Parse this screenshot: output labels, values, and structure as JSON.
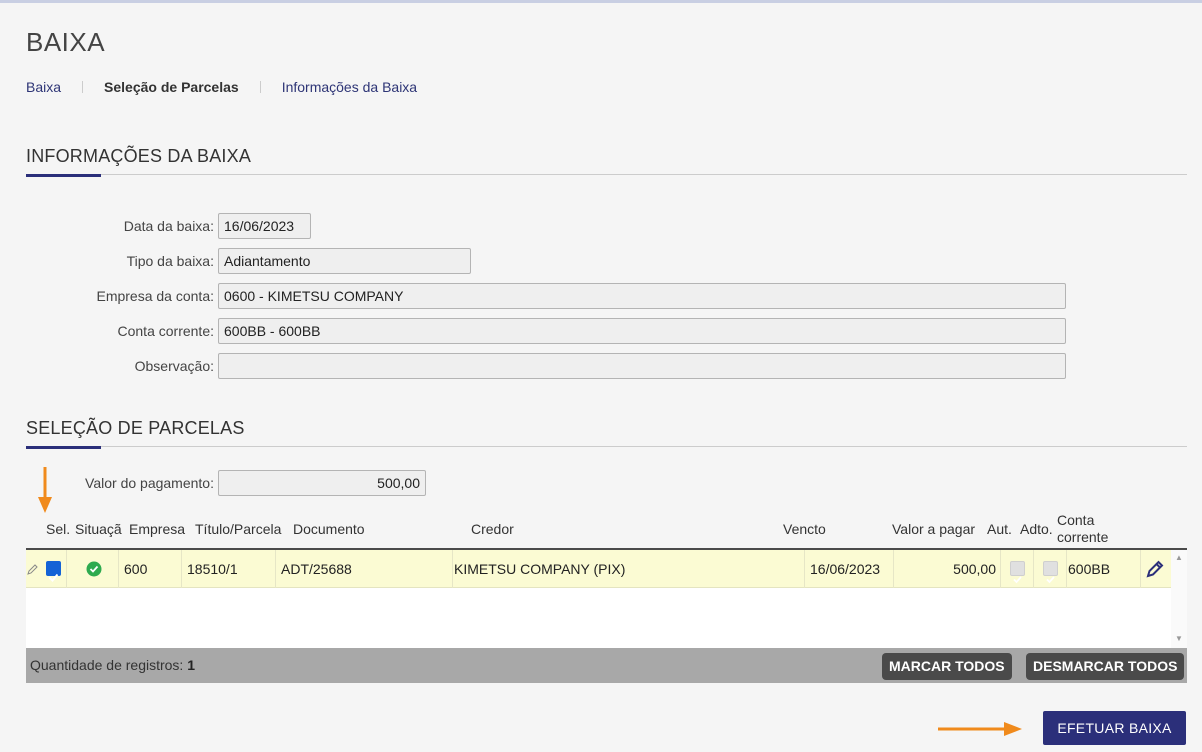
{
  "page": {
    "title": "BAIXA"
  },
  "breadcrumb": [
    {
      "label": "Baixa"
    },
    {
      "label": "Seleção de Parcelas"
    },
    {
      "label": "Informações da Baixa"
    }
  ],
  "info_section": {
    "title": "INFORMAÇÕES DA BAIXA",
    "fields": {
      "data": {
        "label": "Data da baixa:",
        "value": "16/06/2023"
      },
      "tipo": {
        "label": "Tipo da baixa:",
        "value": "Adiantamento"
      },
      "empresa": {
        "label": "Empresa da conta:",
        "value": "0600 - KIMETSU COMPANY"
      },
      "conta": {
        "label": "Conta corrente:",
        "value": "600BB - 600BB"
      },
      "obs": {
        "label": "Observação:",
        "value": ""
      }
    }
  },
  "parcelas_section": {
    "title": "SELEÇÃO DE PARCELAS",
    "valor_label": "Valor do pagamento:",
    "valor_value": "500,00",
    "columns": {
      "sel": "Sel.",
      "situacao": "Situaçã",
      "empresa": "Empresa",
      "titulo": "Título/Parcela",
      "documento": "Documento",
      "credor": "Credor",
      "vencto": "Vencto",
      "valor": "Valor a pagar",
      "aut": "Aut.",
      "adto": "Adto.",
      "conta_l1": "Conta",
      "conta_l2": "corrente"
    },
    "rows": [
      {
        "selected": true,
        "status": "ok",
        "empresa": "600",
        "titulo": "18510/1",
        "documento": "ADT/25688",
        "credor": "KIMETSU COMPANY (PIX)",
        "vencto": "16/06/2023",
        "valor": "500,00",
        "aut": true,
        "adto": true,
        "conta": "600BB"
      }
    ],
    "footer": {
      "records_label": "Quantidade de registros:",
      "records_count": "1",
      "mark_all": "MARCAR TODOS",
      "unmark_all": "DESMARCAR TODOS"
    }
  },
  "actions": {
    "submit": "EFETUAR BAIXA"
  },
  "colors": {
    "primary": "#2b2f7a",
    "row_highlight": "#fbfbd3",
    "annotation_arrow": "#f08a1c",
    "status_ok": "#2eaa4f"
  },
  "icons": {
    "row_edit_left": "pencil-icon",
    "status": "check-circle-icon",
    "row_edit_right": "edit-icon",
    "arrows": "annotation-arrow"
  }
}
